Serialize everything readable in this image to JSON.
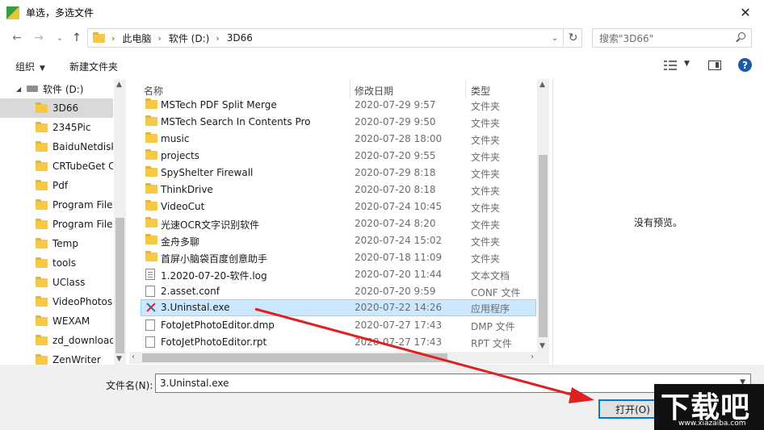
{
  "window": {
    "title": "单选，多选文件",
    "close_glyph": "✕"
  },
  "address": {
    "crumbs": [
      "此电脑",
      "软件 (D:)",
      "3D66"
    ],
    "search_placeholder": "搜索\"3D66\""
  },
  "toolbar": {
    "organize_label": "组织",
    "new_folder_label": "新建文件夹"
  },
  "nav": {
    "drive_label": "软件 (D:)",
    "items": [
      {
        "label": "3D66",
        "selected": true
      },
      {
        "label": "2345Pic"
      },
      {
        "label": "BaiduNetdisk"
      },
      {
        "label": "CRTubeGet C"
      },
      {
        "label": "Pdf"
      },
      {
        "label": "Program Files"
      },
      {
        "label": "Program Files"
      },
      {
        "label": "Temp"
      },
      {
        "label": "tools"
      },
      {
        "label": "UClass"
      },
      {
        "label": "VideoPhotos"
      },
      {
        "label": "WEXAM"
      },
      {
        "label": "zd_download"
      },
      {
        "label": "ZenWriter"
      }
    ]
  },
  "columns": {
    "name": "名称",
    "date": "修改日期",
    "type": "类型"
  },
  "files": [
    {
      "name": "MSTech PDF Split Merge",
      "date": "2020-07-29 9:57",
      "type": "文件夹",
      "icon": "folder-icon"
    },
    {
      "name": "MSTech Search In Contents Pro",
      "date": "2020-07-29 9:50",
      "type": "文件夹",
      "icon": "folder-icon"
    },
    {
      "name": "music",
      "date": "2020-07-28 18:00",
      "type": "文件夹",
      "icon": "folder-icon"
    },
    {
      "name": "projects",
      "date": "2020-07-20 9:55",
      "type": "文件夹",
      "icon": "folder-icon"
    },
    {
      "name": "SpyShelter Firewall",
      "date": "2020-07-29 8:18",
      "type": "文件夹",
      "icon": "folder-icon"
    },
    {
      "name": "ThinkDrive",
      "date": "2020-07-20 8:18",
      "type": "文件夹",
      "icon": "folder-icon"
    },
    {
      "name": "VideoCut",
      "date": "2020-07-24 10:45",
      "type": "文件夹",
      "icon": "folder-icon"
    },
    {
      "name": "光速OCR文字识别软件",
      "date": "2020-07-24 8:20",
      "type": "文件夹",
      "icon": "folder-icon"
    },
    {
      "name": "金舟多聊",
      "date": "2020-07-24 15:02",
      "type": "文件夹",
      "icon": "folder-icon"
    },
    {
      "name": "首屏小脑袋百度创意助手",
      "date": "2020-07-18 11:09",
      "type": "文件夹",
      "icon": "folder-icon"
    },
    {
      "name": "1.2020-07-20-软件.log",
      "date": "2020-07-20 11:44",
      "type": "文本文档",
      "icon": "text-file-icon"
    },
    {
      "name": "2.asset.conf",
      "date": "2020-07-20 9:59",
      "type": "CONF 文件",
      "icon": "file-icon"
    },
    {
      "name": "3.Uninstal.exe",
      "date": "2020-07-22 14:26",
      "type": "应用程序",
      "icon": "exe-icon",
      "selected": true
    },
    {
      "name": "FotoJetPhotoEditor.dmp",
      "date": "2020-07-27 17:43",
      "type": "DMP 文件",
      "icon": "file-icon"
    },
    {
      "name": "FotoJetPhotoEditor.rpt",
      "date": "2020-07-27 17:43",
      "type": "RPT 文件",
      "icon": "file-icon"
    }
  ],
  "preview": {
    "empty_text": "没有预览。"
  },
  "footer": {
    "filename_label": "文件名(N):",
    "filename_value": "3.Uninstal.exe",
    "open_label": "打开(O)"
  },
  "watermark": {
    "logo": "下载吧",
    "url": "www.xiazaiba.com"
  },
  "colors": {
    "selection_bg": "#cce8ff",
    "selection_border": "#99d1ff",
    "accent": "#0078d7",
    "annotation_arrow": "#e02020"
  }
}
